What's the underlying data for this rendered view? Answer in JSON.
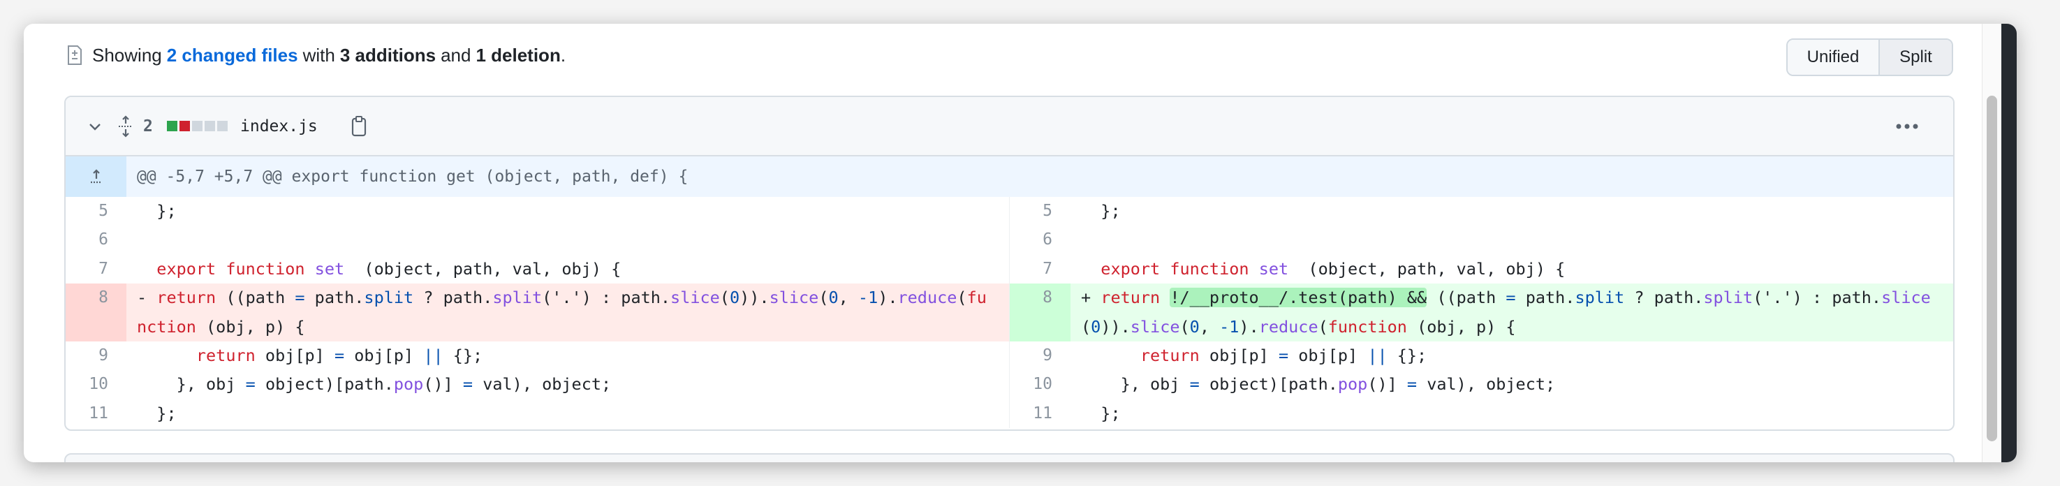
{
  "summary": {
    "prefix": "Showing",
    "files_link": "2 changed files",
    "with": "with",
    "additions": "3 additions",
    "and": "and",
    "deletions": "1 deletion",
    "end": "."
  },
  "view_toggle": {
    "unified": "Unified",
    "split": "Split",
    "selected": "Split"
  },
  "file": {
    "changes": "2",
    "diffstat": [
      "added",
      "deleted",
      "neutral",
      "neutral",
      "neutral"
    ],
    "name": "index.js",
    "hunk_header": "@@ -5,7 +5,7 @@ export function get (object, path, def) {",
    "left": [
      {
        "num": "5",
        "type": "ctx",
        "tokens": [
          {
            "t": "  };",
            "c": "d"
          }
        ]
      },
      {
        "num": "6",
        "type": "ctx",
        "tokens": [
          {
            "t": " ",
            "c": "d"
          }
        ]
      },
      {
        "num": "7",
        "type": "ctx",
        "tokens": [
          {
            "t": "  ",
            "c": "d"
          },
          {
            "t": "export function",
            "c": "k"
          },
          {
            "t": " ",
            "c": "d"
          },
          {
            "t": "set",
            "c": "f"
          },
          {
            "t": "  (object, path, val, obj) {",
            "c": "d"
          }
        ]
      },
      {
        "num": "8",
        "type": "del",
        "tokens": [
          {
            "t": "- ",
            "c": "d"
          },
          {
            "t": "return",
            "c": "k"
          },
          {
            "t": " ((path ",
            "c": "d"
          },
          {
            "t": "=",
            "c": "b"
          },
          {
            "t": " path.",
            "c": "d"
          },
          {
            "t": "split",
            "c": "b"
          },
          {
            "t": " ? path.",
            "c": "d"
          },
          {
            "t": "split",
            "c": "f"
          },
          {
            "t": "('.') : path.",
            "c": "d"
          },
          {
            "t": "slice",
            "c": "f"
          },
          {
            "t": "(",
            "c": "d"
          },
          {
            "t": "0",
            "c": "b"
          },
          {
            "t": ")).",
            "c": "d"
          },
          {
            "t": "slice",
            "c": "f"
          },
          {
            "t": "(",
            "c": "d"
          },
          {
            "t": "0",
            "c": "b"
          },
          {
            "t": ", ",
            "c": "d"
          },
          {
            "t": "-1",
            "c": "b"
          },
          {
            "t": ").",
            "c": "d"
          },
          {
            "t": "reduce",
            "c": "f"
          },
          {
            "t": "(",
            "c": "d"
          },
          {
            "t": "function",
            "c": "k"
          },
          {
            "t": " (obj, p) {",
            "c": "d"
          }
        ]
      },
      {
        "num": "9",
        "type": "ctx",
        "tokens": [
          {
            "t": "      ",
            "c": "d"
          },
          {
            "t": "return",
            "c": "k"
          },
          {
            "t": " obj[p] ",
            "c": "d"
          },
          {
            "t": "=",
            "c": "b"
          },
          {
            "t": " obj[p] ",
            "c": "d"
          },
          {
            "t": "||",
            "c": "b"
          },
          {
            "t": " {};",
            "c": "d"
          }
        ]
      },
      {
        "num": "10",
        "type": "ctx",
        "tokens": [
          {
            "t": "    }, obj ",
            "c": "d"
          },
          {
            "t": "=",
            "c": "b"
          },
          {
            "t": " object)[path.",
            "c": "d"
          },
          {
            "t": "pop",
            "c": "f"
          },
          {
            "t": "()] ",
            "c": "d"
          },
          {
            "t": "=",
            "c": "b"
          },
          {
            "t": " val), object;",
            "c": "d"
          }
        ]
      },
      {
        "num": "11",
        "type": "ctx",
        "tokens": [
          {
            "t": "  };",
            "c": "d"
          }
        ]
      }
    ],
    "right": [
      {
        "num": "5",
        "type": "ctx",
        "tokens": [
          {
            "t": "  };",
            "c": "d"
          }
        ]
      },
      {
        "num": "6",
        "type": "ctx",
        "tokens": [
          {
            "t": " ",
            "c": "d"
          }
        ]
      },
      {
        "num": "7",
        "type": "ctx",
        "tokens": [
          {
            "t": "  ",
            "c": "d"
          },
          {
            "t": "export function",
            "c": "k"
          },
          {
            "t": " ",
            "c": "d"
          },
          {
            "t": "set",
            "c": "f"
          },
          {
            "t": "  (object, path, val, obj) {",
            "c": "d"
          }
        ]
      },
      {
        "num": "8",
        "type": "add",
        "tokens": [
          {
            "t": "+ ",
            "c": "d"
          },
          {
            "t": "return",
            "c": "k"
          },
          {
            "t": " ",
            "c": "d"
          },
          {
            "t": "!/__proto__/.test(path) &&",
            "c": "d",
            "hl": true
          },
          {
            "t": " ((path ",
            "c": "d"
          },
          {
            "t": "=",
            "c": "b"
          },
          {
            "t": " path.",
            "c": "d"
          },
          {
            "t": "split",
            "c": "b"
          },
          {
            "t": " ? path.",
            "c": "d"
          },
          {
            "t": "split",
            "c": "f"
          },
          {
            "t": "('.') : ",
            "c": "d"
          },
          {
            "t": "path.",
            "c": "d"
          },
          {
            "t": "slice",
            "c": "f"
          },
          {
            "t": "(",
            "c": "d"
          },
          {
            "t": "0",
            "c": "b"
          },
          {
            "t": ")).",
            "c": "d"
          },
          {
            "t": "slice",
            "c": "f"
          },
          {
            "t": "(",
            "c": "d"
          },
          {
            "t": "0",
            "c": "b"
          },
          {
            "t": ", ",
            "c": "d"
          },
          {
            "t": "-1",
            "c": "b"
          },
          {
            "t": ").",
            "c": "d"
          },
          {
            "t": "reduce",
            "c": "f"
          },
          {
            "t": "(",
            "c": "d"
          },
          {
            "t": "function",
            "c": "k"
          },
          {
            "t": " (obj, p) {",
            "c": "d"
          }
        ]
      },
      {
        "num": "9",
        "type": "ctx",
        "tokens": [
          {
            "t": "      ",
            "c": "d"
          },
          {
            "t": "return",
            "c": "k"
          },
          {
            "t": " obj[p] ",
            "c": "d"
          },
          {
            "t": "=",
            "c": "b"
          },
          {
            "t": " obj[p] ",
            "c": "d"
          },
          {
            "t": "||",
            "c": "b"
          },
          {
            "t": " {};",
            "c": "d"
          }
        ]
      },
      {
        "num": "10",
        "type": "ctx",
        "tokens": [
          {
            "t": "    }, obj ",
            "c": "d"
          },
          {
            "t": "=",
            "c": "b"
          },
          {
            "t": " object)[path.",
            "c": "d"
          },
          {
            "t": "pop",
            "c": "f"
          },
          {
            "t": "()] ",
            "c": "d"
          },
          {
            "t": "=",
            "c": "b"
          },
          {
            "t": " val), object;",
            "c": "d"
          }
        ]
      },
      {
        "num": "11",
        "type": "ctx",
        "tokens": [
          {
            "t": "  };",
            "c": "d"
          }
        ]
      }
    ]
  },
  "colors": {
    "added": "#2da44e",
    "deleted": "#cf222e",
    "neutral": "#d0d7de",
    "link": "#0969da",
    "del_bg": "#ffebe9",
    "add_bg": "#e6ffec",
    "add_highlight": "#abf2bc"
  },
  "icons": [
    "file-diff-icon",
    "chevron-down-icon",
    "unfold-icon",
    "copy-icon",
    "kebab-icon",
    "expand-up-icon"
  ]
}
